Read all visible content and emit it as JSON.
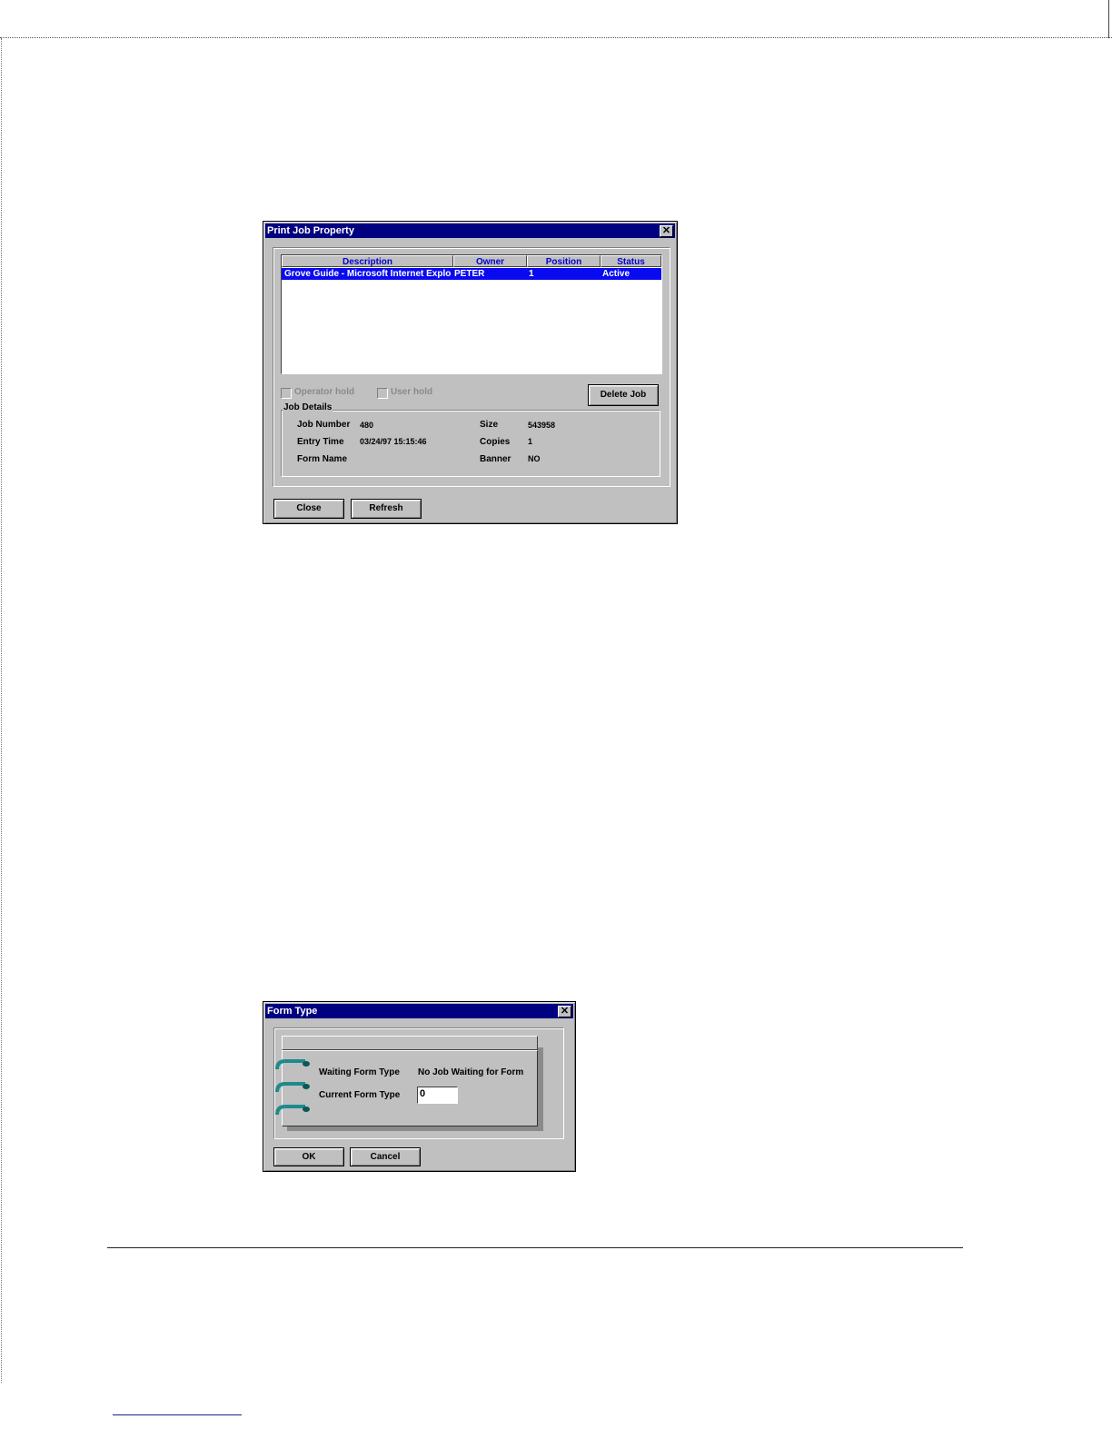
{
  "print_job_dialog": {
    "title": "Print Job Property",
    "close_glyph": "✕",
    "columns": [
      "Description",
      "Owner",
      "Position",
      "Status"
    ],
    "rows": [
      {
        "description": "Grove Guide - Microsoft Internet Explo",
        "owner": "PETER",
        "position": "1",
        "status": "Active"
      }
    ],
    "operator_hold_label": "Operator hold",
    "user_hold_label": "User hold",
    "delete_job_label": "Delete Job",
    "job_details": {
      "title": "Job Details",
      "job_number_label": "Job Number",
      "job_number": "480",
      "entry_time_label": "Entry Time",
      "entry_time": "03/24/97 15:15:46",
      "form_name_label": "Form Name",
      "form_name": "",
      "size_label": "Size",
      "size": "543958",
      "copies_label": "Copies",
      "copies": "1",
      "banner_label": "Banner",
      "banner": "NO"
    },
    "close_button": "Close",
    "refresh_button": "Refresh"
  },
  "form_type_dialog": {
    "title": "Form Type",
    "close_glyph": "✕",
    "waiting_label": "Waiting Form Type",
    "waiting_value": "No Job Waiting for Form",
    "current_label": "Current Form Type",
    "current_value": "0",
    "ok_button": "OK",
    "cancel_button": "Cancel",
    "ring_icon": "binder-ring-icon",
    "ring_color": "#1f8a8a"
  }
}
